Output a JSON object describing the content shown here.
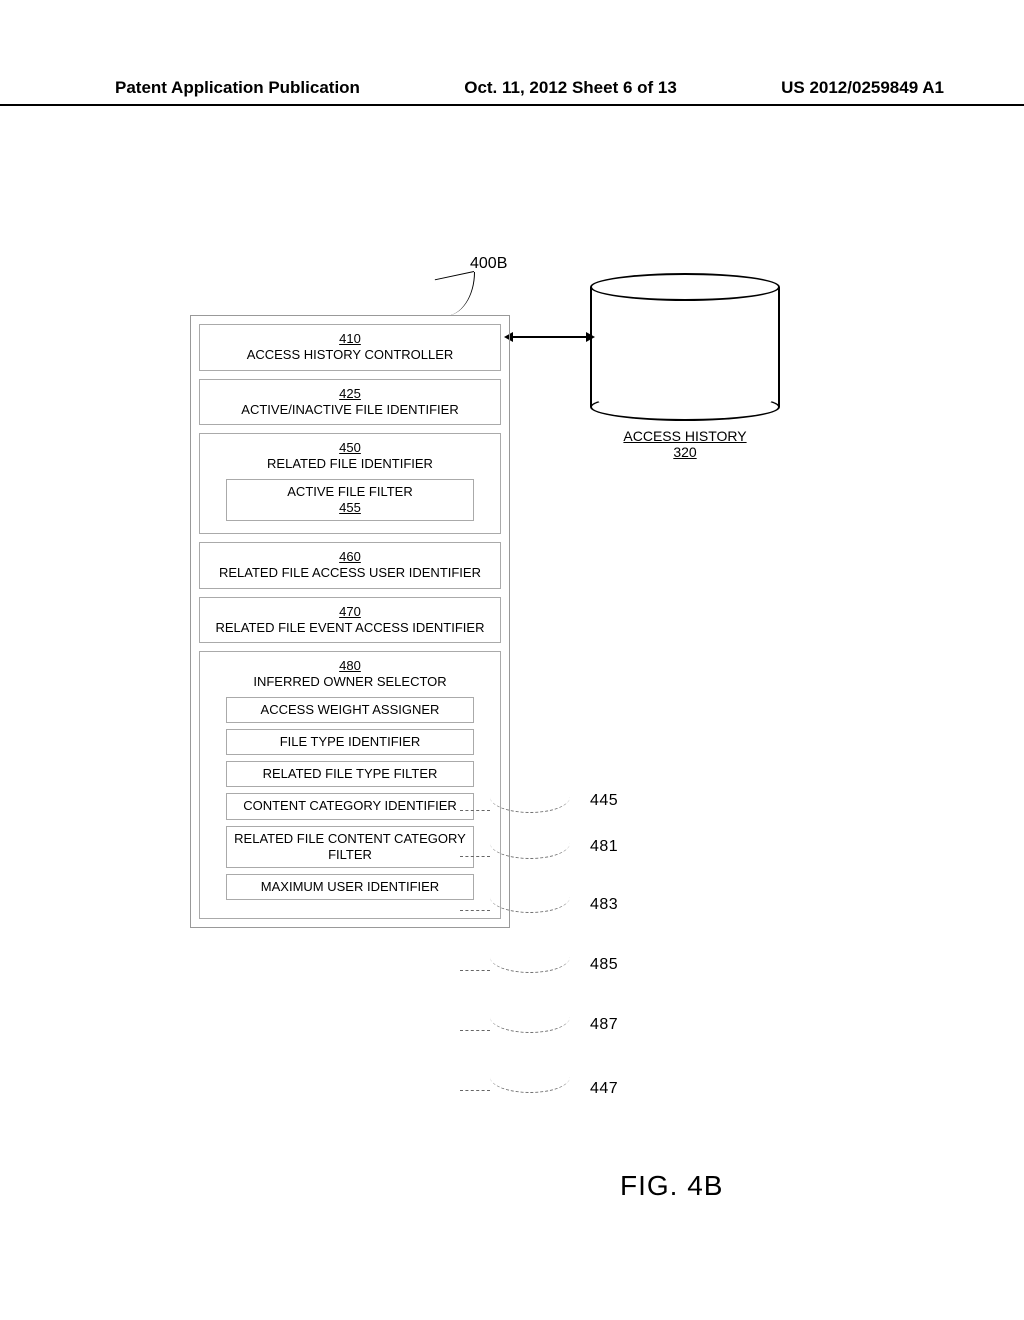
{
  "header": {
    "left": "Patent Application Publication",
    "center": "Oct. 11, 2012  Sheet 6 of 13",
    "right": "US 2012/0259849 A1"
  },
  "system_ref": "400B",
  "db": {
    "title": "ACCESS HISTORY",
    "ref": "320"
  },
  "modules": {
    "m410": {
      "ref": "410",
      "name": "ACCESS HISTORY CONTROLLER"
    },
    "m425": {
      "ref": "425",
      "name": "ACTIVE/INACTIVE FILE IDENTIFIER"
    },
    "m450": {
      "ref": "450",
      "name": "RELATED FILE IDENTIFIER",
      "sub": {
        "name": "ACTIVE FILE FILTER",
        "ref": "455"
      }
    },
    "m460": {
      "ref": "460",
      "name": "RELATED FILE ACCESS USER IDENTIFIER"
    },
    "m470": {
      "ref": "470",
      "name": "RELATED FILE EVENT ACCESS IDENTIFIER"
    },
    "m480": {
      "ref": "480",
      "name": "INFERRED OWNER SELECTOR",
      "subs": [
        {
          "name": "ACCESS WEIGHT ASSIGNER",
          "ref": "445"
        },
        {
          "name": "FILE TYPE IDENTIFIER",
          "ref": "481"
        },
        {
          "name": "RELATED  FILE TYPE FILTER",
          "ref": "483"
        },
        {
          "name": "CONTENT CATEGORY IDENTIFIER",
          "ref": "485"
        },
        {
          "name": "RELATED FILE CONTENT CATEGORY FILTER",
          "ref": "487"
        },
        {
          "name": "MAXIMUM USER IDENTIFIER",
          "ref": "447"
        }
      ]
    }
  },
  "figure_label": "FIG. 4B"
}
